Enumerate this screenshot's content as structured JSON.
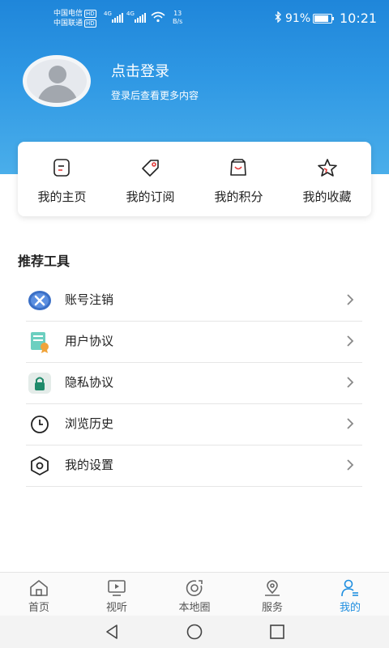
{
  "status_bar": {
    "carrier1": "中国电信",
    "carrier2": "中国联通",
    "hd": "HD",
    "net1": "4G",
    "net2": "4G",
    "speed_value": "13",
    "speed_unit": "B/s",
    "battery": "91%",
    "time": "10:21"
  },
  "profile": {
    "login_title": "点击登录",
    "login_subtitle": "登录后查看更多内容"
  },
  "quick_actions": [
    {
      "label": "我的主页",
      "icon": "homepage-icon"
    },
    {
      "label": "我的订阅",
      "icon": "tag-icon"
    },
    {
      "label": "我的积分",
      "icon": "shopping-bag-icon"
    },
    {
      "label": "我的收藏",
      "icon": "star-icon"
    }
  ],
  "tools": {
    "title": "推荐工具",
    "items": [
      {
        "label": "账号注销",
        "icon": "cancel-account-icon"
      },
      {
        "label": "用户协议",
        "icon": "user-agreement-icon"
      },
      {
        "label": "隐私协议",
        "icon": "privacy-lock-icon"
      },
      {
        "label": "浏览历史",
        "icon": "clock-icon"
      },
      {
        "label": "我的设置",
        "icon": "settings-hexagon-icon"
      }
    ]
  },
  "tab_bar": {
    "items": [
      {
        "label": "首页",
        "icon": "home-icon"
      },
      {
        "label": "视听",
        "icon": "tv-icon"
      },
      {
        "label": "本地圈",
        "icon": "local-circle-icon"
      },
      {
        "label": "服务",
        "icon": "map-pin-icon"
      },
      {
        "label": "我的",
        "icon": "user-icon"
      }
    ],
    "active_index": 4,
    "active_color": "#1e8ee0"
  },
  "theme": {
    "header_color": "#2a90e0"
  }
}
